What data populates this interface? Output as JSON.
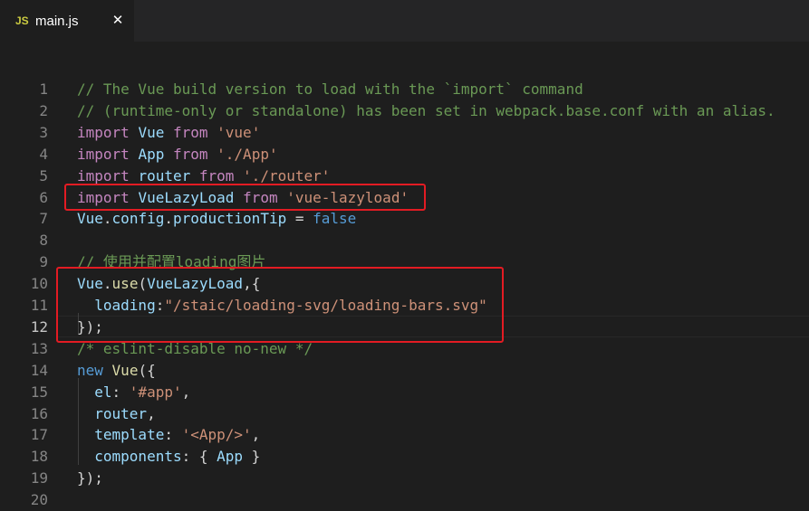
{
  "tab": {
    "icon_text": "JS",
    "filename": "main.js",
    "close": "✕"
  },
  "lines": [
    {
      "n": "1",
      "tokens": [
        [
          "c",
          "// The Vue build version to load with the `import` command"
        ]
      ]
    },
    {
      "n": "2",
      "tokens": [
        [
          "c",
          "// (runtime-only or standalone) has been set in webpack.base.conf with an alias."
        ]
      ]
    },
    {
      "n": "3",
      "tokens": [
        [
          "k",
          "import"
        ],
        [
          "p",
          " "
        ],
        [
          "v",
          "Vue"
        ],
        [
          "p",
          " "
        ],
        [
          "k",
          "from"
        ],
        [
          "p",
          " "
        ],
        [
          "s",
          "'vue'"
        ]
      ]
    },
    {
      "n": "4",
      "tokens": [
        [
          "k",
          "import"
        ],
        [
          "p",
          " "
        ],
        [
          "v",
          "App"
        ],
        [
          "p",
          " "
        ],
        [
          "k",
          "from"
        ],
        [
          "p",
          " "
        ],
        [
          "s",
          "'./App'"
        ]
      ]
    },
    {
      "n": "5",
      "tokens": [
        [
          "k",
          "import"
        ],
        [
          "p",
          " "
        ],
        [
          "v",
          "router"
        ],
        [
          "p",
          " "
        ],
        [
          "k",
          "from"
        ],
        [
          "p",
          " "
        ],
        [
          "s",
          "'./router'"
        ]
      ]
    },
    {
      "n": "6",
      "tokens": [
        [
          "k",
          "import"
        ],
        [
          "p",
          " "
        ],
        [
          "v",
          "VueLazyLoad"
        ],
        [
          "p",
          " "
        ],
        [
          "k",
          "from"
        ],
        [
          "p",
          " "
        ],
        [
          "s",
          "'vue-lazyload'"
        ]
      ]
    },
    {
      "n": "7",
      "tokens": [
        [
          "v",
          "Vue"
        ],
        [
          "p",
          "."
        ],
        [
          "v",
          "config"
        ],
        [
          "p",
          "."
        ],
        [
          "v",
          "productionTip"
        ],
        [
          "p",
          " = "
        ],
        [
          "b",
          "false"
        ]
      ]
    },
    {
      "n": "8",
      "tokens": []
    },
    {
      "n": "9",
      "tokens": [
        [
          "c",
          "// 使用并配置loading图片"
        ]
      ]
    },
    {
      "n": "10",
      "tokens": [
        [
          "v",
          "Vue"
        ],
        [
          "p",
          "."
        ],
        [
          "f",
          "use"
        ],
        [
          "p",
          "("
        ],
        [
          "v",
          "VueLazyLoad"
        ],
        [
          "p",
          ",{"
        ]
      ]
    },
    {
      "n": "11",
      "tokens": [
        [
          "p",
          "  "
        ],
        [
          "v",
          "loading"
        ],
        [
          "p",
          ":"
        ],
        [
          "s",
          "\"/staic/loading-svg/loading-bars.svg\""
        ]
      ]
    },
    {
      "n": "12",
      "tokens": [
        [
          "p",
          "});"
        ]
      ]
    },
    {
      "n": "13",
      "tokens": [
        [
          "c",
          "/* eslint-disable no-new */"
        ]
      ]
    },
    {
      "n": "14",
      "tokens": [
        [
          "b",
          "new"
        ],
        [
          "p",
          " "
        ],
        [
          "f",
          "Vue"
        ],
        [
          "p",
          "({"
        ]
      ]
    },
    {
      "n": "15",
      "tokens": [
        [
          "p",
          "  "
        ],
        [
          "v",
          "el"
        ],
        [
          "p",
          ": "
        ],
        [
          "s",
          "'#app'"
        ],
        [
          "p",
          ","
        ]
      ]
    },
    {
      "n": "16",
      "tokens": [
        [
          "p",
          "  "
        ],
        [
          "v",
          "router"
        ],
        [
          "p",
          ","
        ]
      ]
    },
    {
      "n": "17",
      "tokens": [
        [
          "p",
          "  "
        ],
        [
          "v",
          "template"
        ],
        [
          "p",
          ": "
        ],
        [
          "s",
          "'<App/>'"
        ],
        [
          "p",
          ","
        ]
      ]
    },
    {
      "n": "18",
      "tokens": [
        [
          "p",
          "  "
        ],
        [
          "v",
          "components"
        ],
        [
          "p",
          ": { "
        ],
        [
          "v",
          "App"
        ],
        [
          "p",
          " }"
        ]
      ]
    },
    {
      "n": "19",
      "tokens": [
        [
          "p",
          "});"
        ]
      ]
    },
    {
      "n": "20",
      "tokens": []
    }
  ],
  "active_line": "12",
  "colors": {
    "comment": "#6a9955",
    "keyword": "#c586c0",
    "variable": "#9cdcfe",
    "string": "#ce9178",
    "function": "#dcdcaa",
    "constant": "#569cd6",
    "highlight_box": "#e31b23"
  }
}
